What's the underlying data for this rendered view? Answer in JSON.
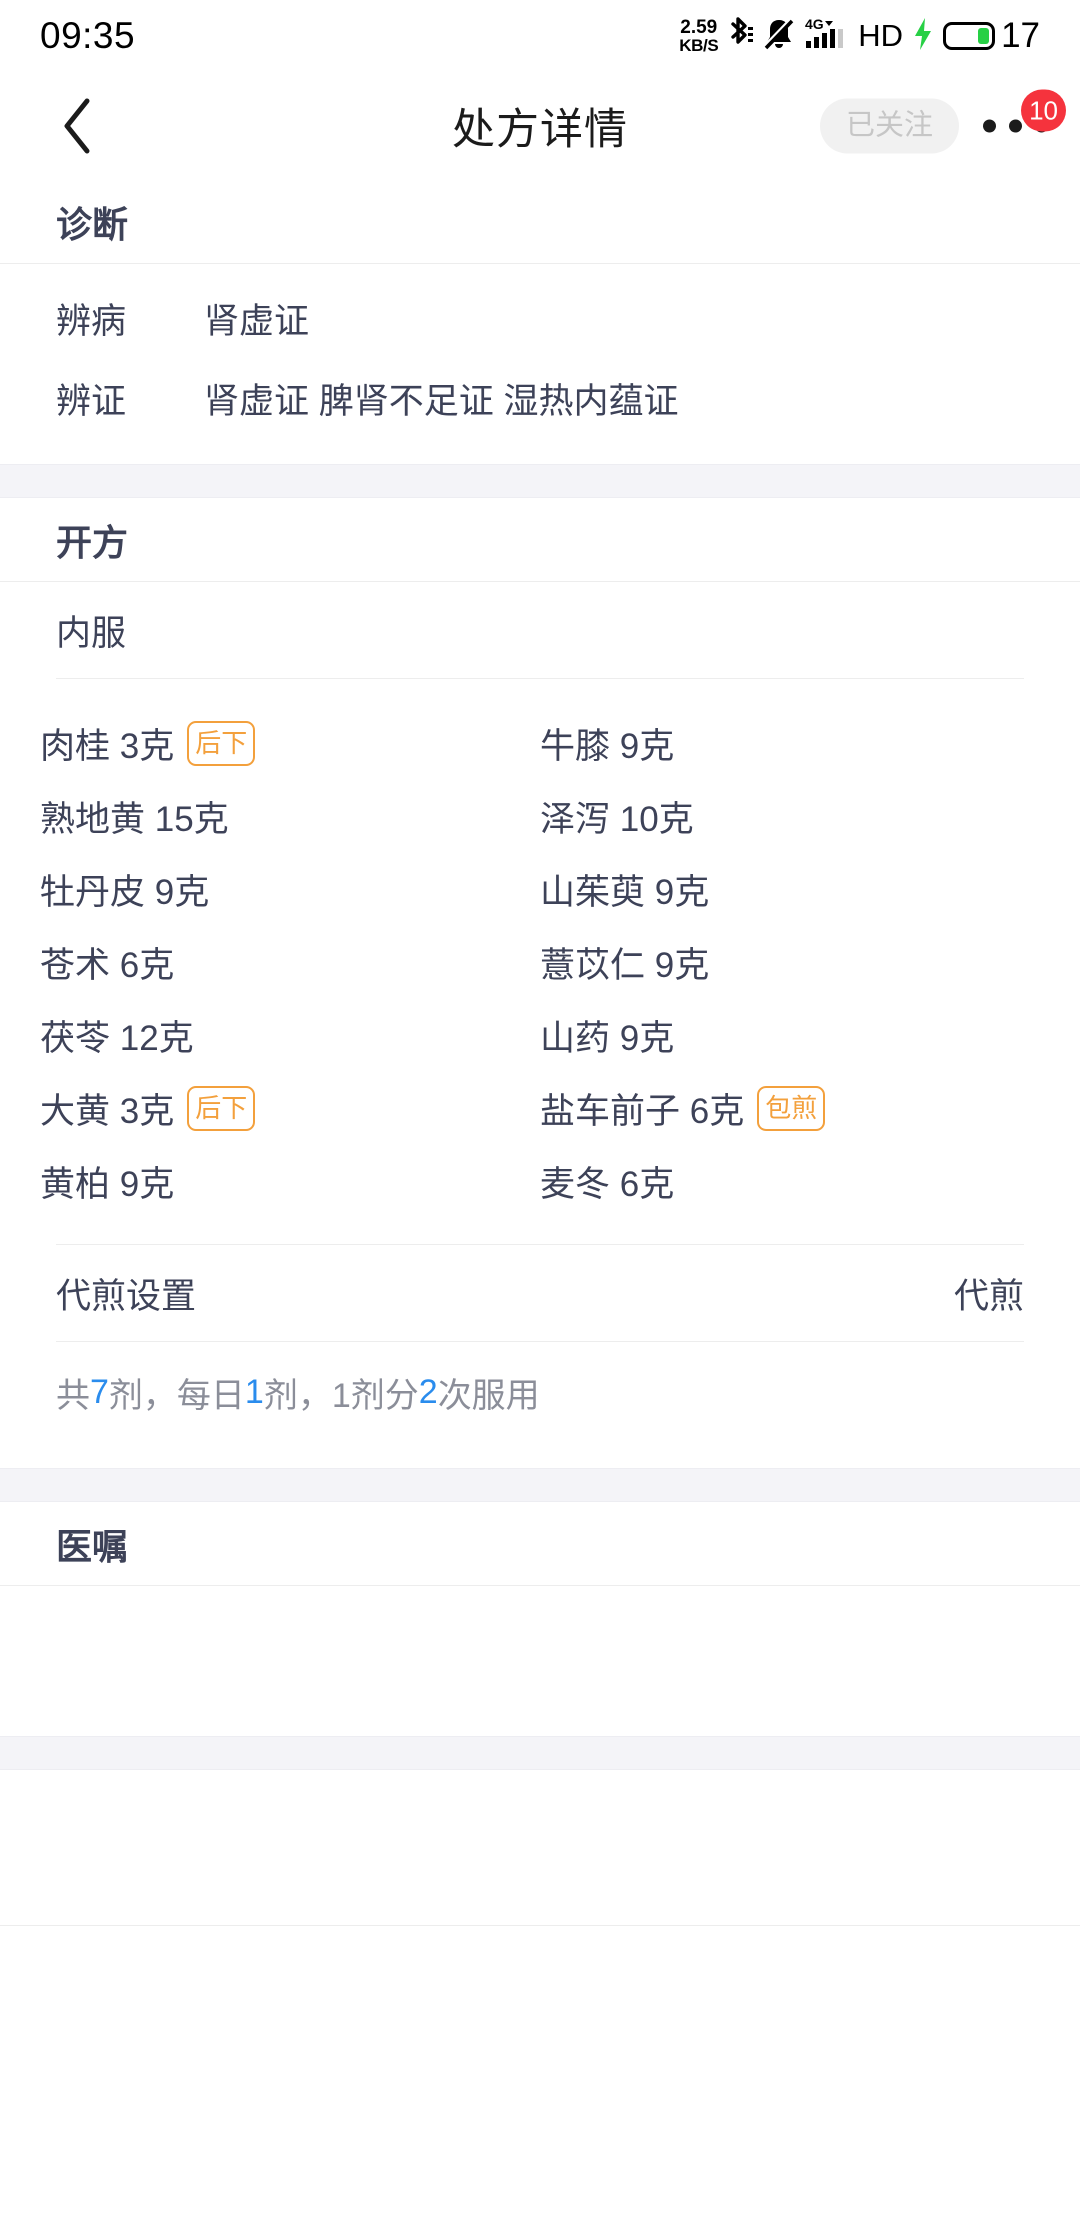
{
  "status_bar": {
    "time": "09:35",
    "net_speed_value": "2.59",
    "net_speed_unit": "KB/S",
    "bluetooth_icon": "bluetooth-icon",
    "mute_icon": "bell-mute-icon",
    "signal_icon": "signal-4g-icon",
    "signal_label": "4G",
    "hd_label": "HD",
    "charging_icon": "charging-bolt-icon",
    "battery_level": "17"
  },
  "nav": {
    "back_icon": "back-chevron-icon",
    "title": "处方详情",
    "follow_label": "已关注",
    "more_icon": "more-dots-icon",
    "badge_count": "10"
  },
  "diagnosis": {
    "section_title": "诊断",
    "rows": [
      {
        "label": "辨病",
        "value": "肾虚证"
      },
      {
        "label": "辨证",
        "value": "肾虚证 脾肾不足证 湿热内蕴证"
      }
    ]
  },
  "prescription": {
    "section_title": "开方",
    "sub_title": "内服",
    "herbs": [
      {
        "name": "肉桂 3克",
        "tag": "后下",
        "name2": "牛膝 9克",
        "tag2": ""
      },
      {
        "name": "熟地黄 15克",
        "tag": "",
        "name2": "泽泻 10克",
        "tag2": ""
      },
      {
        "name": "牡丹皮 9克",
        "tag": "",
        "name2": "山茱萸 9克",
        "tag2": ""
      },
      {
        "name": "苍术 6克",
        "tag": "",
        "name2": "薏苡仁 9克",
        "tag2": ""
      },
      {
        "name": "茯苓 12克",
        "tag": "",
        "name2": "山药 9克",
        "tag2": ""
      },
      {
        "name": "大黄 3克",
        "tag": "后下",
        "name2": "盐车前子 6克",
        "tag2": "包煎"
      },
      {
        "name": "黄柏 9克",
        "tag": "",
        "name2": "麦冬 6克",
        "tag2": ""
      }
    ],
    "decoct_label": "代煎设置",
    "decoct_value": "代煎",
    "dose": {
      "p1": "共",
      "n1": "7",
      "p2": "剂，每日",
      "n2": "1",
      "p3": "剂，1剂分",
      "n3": "2",
      "p4": "次服用"
    }
  },
  "advice": {
    "section_title": "医嘱"
  },
  "colors": {
    "text_primary": "#3d4258",
    "text_muted": "#8b8e99",
    "accent_blue": "#2a8ced",
    "tag_orange": "#f3a03c",
    "badge_red": "#f5333d",
    "band_gray": "#f4f4f8",
    "battery_green": "#27d045"
  }
}
